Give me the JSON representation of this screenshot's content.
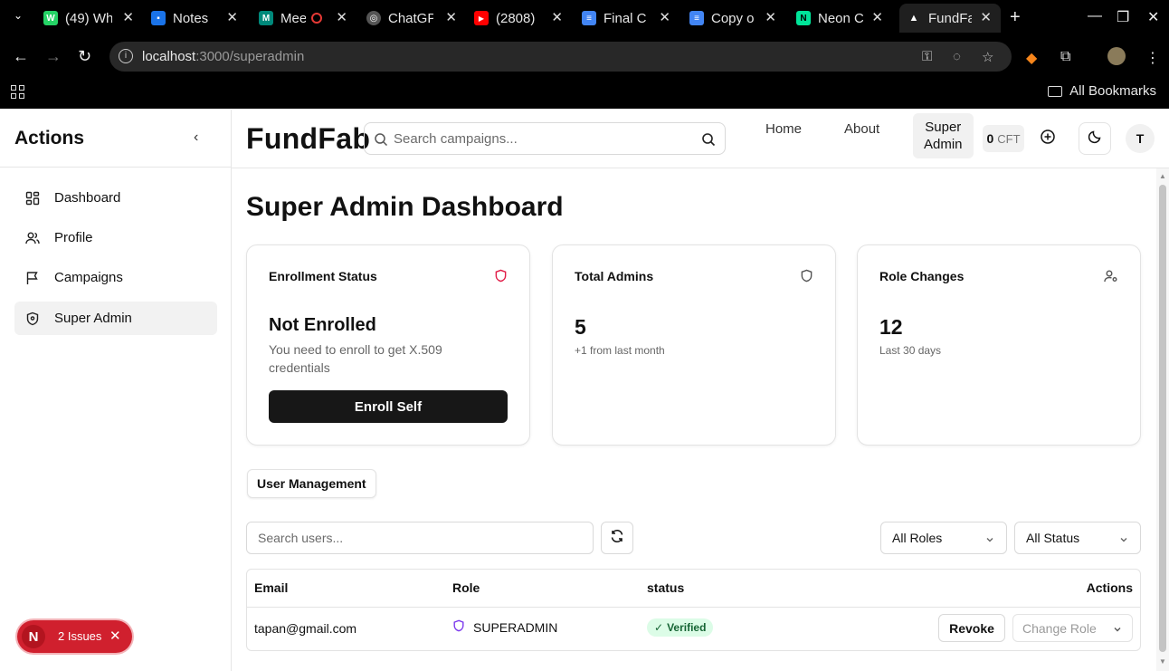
{
  "browser": {
    "tabs": [
      {
        "title": "(49) Wh",
        "color": "#25d366",
        "glyph": "W"
      },
      {
        "title": "Notes",
        "color": "#1a73e8",
        "glyph": "N"
      },
      {
        "title": "Mee",
        "color": "#00897b",
        "glyph": "M"
      },
      {
        "title": "ChatGP",
        "color": "#555555",
        "glyph": "C"
      },
      {
        "title": "(2808)",
        "color": "#ff0000",
        "glyph": "▶"
      },
      {
        "title": "Final C",
        "color": "#4285f4",
        "glyph": "≡"
      },
      {
        "title": "Copy o",
        "color": "#4285f4",
        "glyph": "≡"
      },
      {
        "title": "Neon C",
        "color": "#00e599",
        "glyph": "N"
      },
      {
        "title": "FundFa",
        "color": "#ffffff",
        "glyph": "▲"
      }
    ],
    "url_host": "localhost",
    "url_path": ":3000/superadmin",
    "bookmarks_label": "All Bookmarks"
  },
  "sidebar": {
    "title": "Actions",
    "items": [
      {
        "label": "Dashboard",
        "icon": "dashboard-icon"
      },
      {
        "label": "Profile",
        "icon": "users-icon"
      },
      {
        "label": "Campaigns",
        "icon": "flag-icon"
      },
      {
        "label": "Super Admin",
        "icon": "shield-icon"
      }
    ]
  },
  "header": {
    "brand": "FundFab",
    "search_placeholder": "Search campaigns...",
    "nav": {
      "home": "Home",
      "about": "About",
      "super_admin_1": "Super",
      "super_admin_2": "Admin"
    },
    "cft_amount": "0",
    "cft_unit": "CFT",
    "avatar_initial": "T"
  },
  "main": {
    "title": "Super Admin Dashboard",
    "cards": {
      "enrollment": {
        "title": "Enrollment Status",
        "status": "Not Enrolled",
        "description": "You need to enroll to get X.509 credentials",
        "button": "Enroll Self"
      },
      "admins": {
        "title": "Total Admins",
        "value": "5",
        "sub": "+1 from last month"
      },
      "roles": {
        "title": "Role Changes",
        "value": "12",
        "sub": "Last 30 days"
      }
    },
    "user_management": {
      "tab": "User Management",
      "search_placeholder": "Search users...",
      "role_filter": "All Roles",
      "status_filter": "All Status",
      "columns": {
        "email": "Email",
        "role": "Role",
        "status": "status",
        "actions": "Actions"
      },
      "rows": [
        {
          "email": "tapan@gmail.com",
          "role": "SUPERADMIN",
          "status": "Verified",
          "revoke": "Revoke",
          "change_role": "Change Role"
        }
      ]
    }
  },
  "devtools": {
    "badge": "N",
    "issues": "2 Issues"
  },
  "colors": {
    "accent_dark": "#171717",
    "verified_bg": "#dcfce7",
    "verified_fg": "#166534",
    "issues_red": "#d0202e",
    "enroll_shield": "#e11d48",
    "role_shield": "#7c3aed"
  }
}
